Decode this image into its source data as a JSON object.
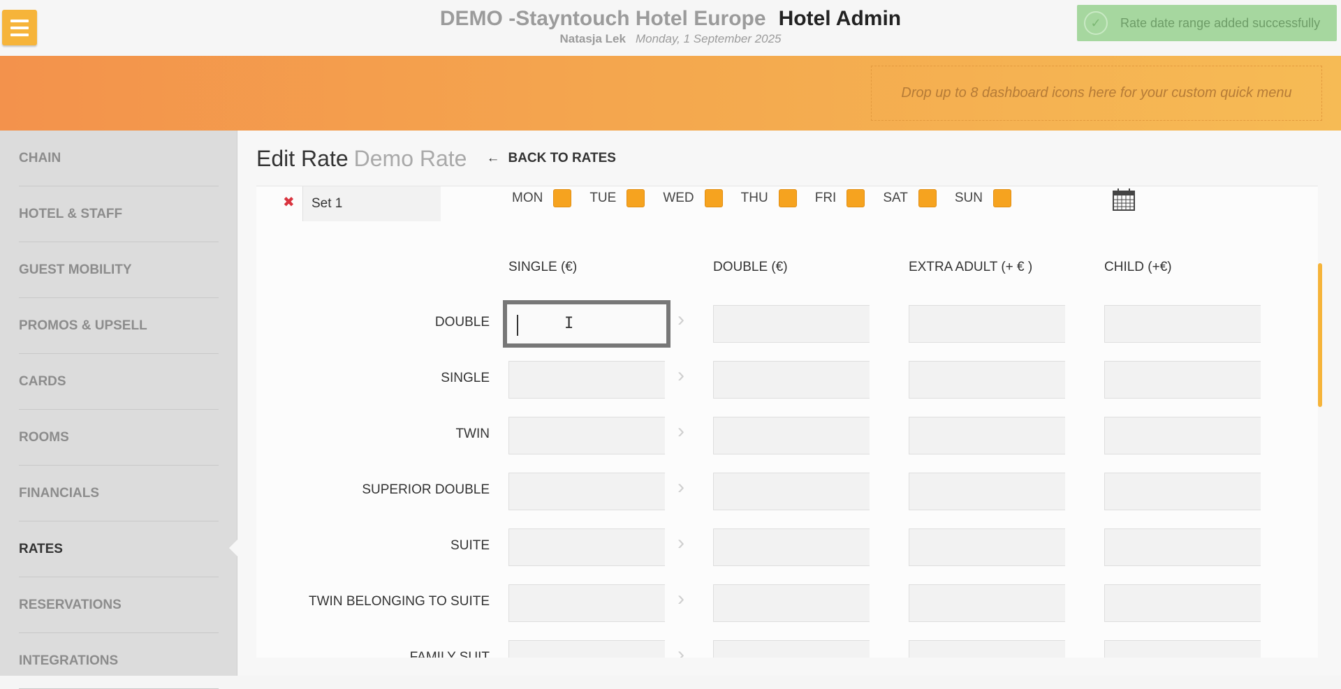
{
  "header": {
    "hotel_name": "DEMO -Stayntouch Hotel Europe",
    "app_name": "Hotel Admin",
    "user_name": "Natasja Lek",
    "date": "Monday, 1 September 2025"
  },
  "toast": {
    "message": "Rate date range added successfully",
    "icon": "check-circle-icon"
  },
  "quick_menu": {
    "placeholder": "Drop up to 8 dashboard icons here for your custom quick menu"
  },
  "sidebar": {
    "items": [
      {
        "label": "CHAIN"
      },
      {
        "label": "HOTEL & STAFF"
      },
      {
        "label": "GUEST MOBILITY"
      },
      {
        "label": "PROMOS & UPSELL"
      },
      {
        "label": "CARDS"
      },
      {
        "label": "ROOMS"
      },
      {
        "label": "FINANCIALS"
      },
      {
        "label": "RATES"
      },
      {
        "label": "RESERVATIONS"
      },
      {
        "label": "INTEGRATIONS"
      }
    ],
    "active": "RATES"
  },
  "page": {
    "title": "Edit Rate",
    "rate_name": "Demo Rate",
    "back_label": "BACK TO RATES"
  },
  "set": {
    "name": "Set 1",
    "days": [
      {
        "label": "MON",
        "checked": true
      },
      {
        "label": "TUE",
        "checked": true
      },
      {
        "label": "WED",
        "checked": true
      },
      {
        "label": "THU",
        "checked": true
      },
      {
        "label": "FRI",
        "checked": true
      },
      {
        "label": "SAT",
        "checked": true
      },
      {
        "label": "SUN",
        "checked": true
      }
    ]
  },
  "table": {
    "columns": [
      "SINGLE (€)",
      "DOUBLE (€)",
      "EXTRA ADULT (+ € )",
      "CHILD (+€)"
    ],
    "rows": [
      "DOUBLE",
      "SINGLE",
      "TWIN",
      "SUPERIOR DOUBLE",
      "SUITE",
      "TWIN BELONGING TO SUITE",
      "FAMILY SUIT"
    ],
    "values": [
      [
        "",
        "",
        "",
        ""
      ],
      [
        "",
        "",
        "",
        ""
      ],
      [
        "",
        "",
        "",
        ""
      ],
      [
        "",
        "",
        "",
        ""
      ],
      [
        "",
        "",
        "",
        ""
      ],
      [
        "",
        "",
        "",
        ""
      ],
      [
        "",
        "",
        "",
        ""
      ]
    ]
  },
  "colors": {
    "accent": "#f6a31f",
    "banner_start": "#f3924c",
    "banner_end": "#f6bb55",
    "toast_bg": "#a6d79f",
    "remove": "#d9343f"
  }
}
